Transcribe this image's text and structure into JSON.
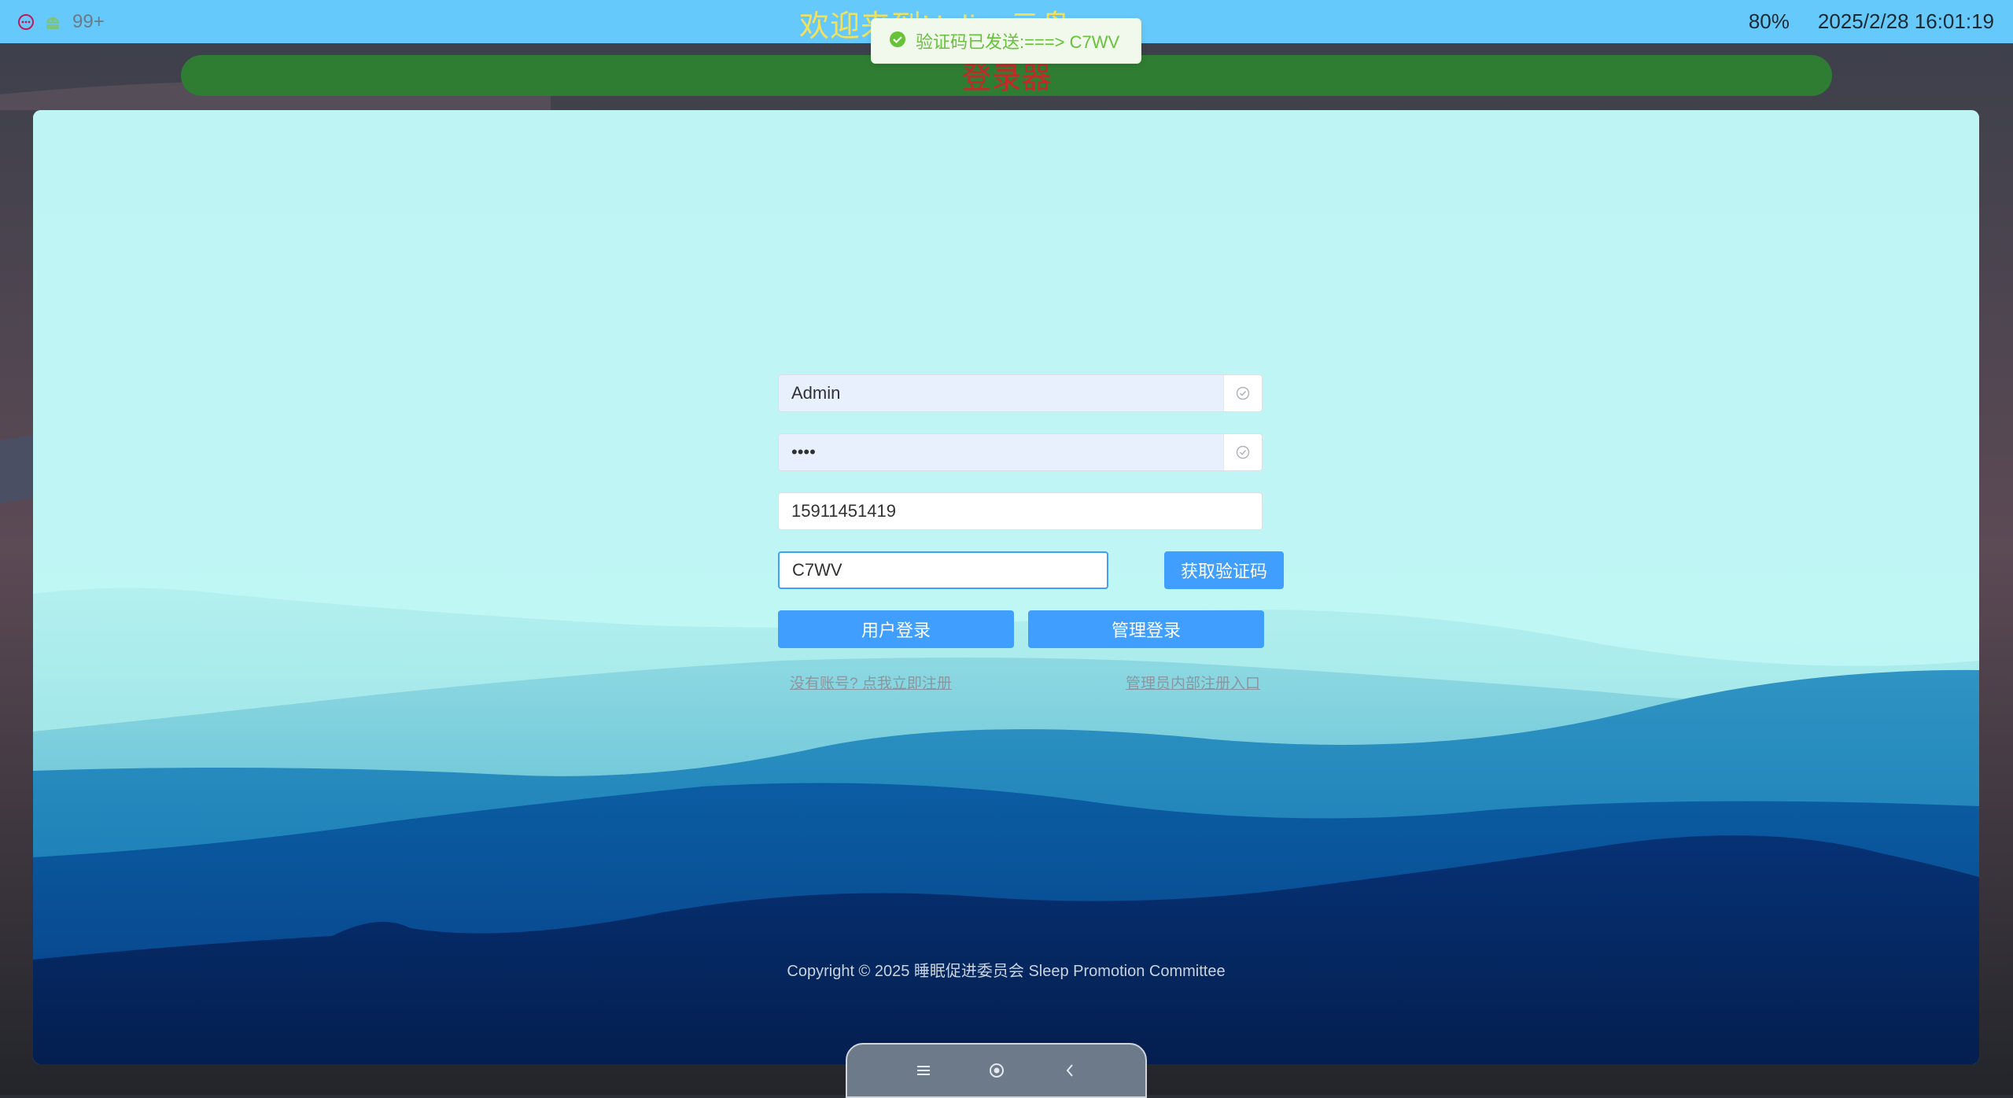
{
  "statusbar": {
    "badge_count": "99+",
    "title": "欢迎来到Helios云盘",
    "zoom": "80%",
    "datetime": "2025/2/28 16:01:19"
  },
  "banner": {
    "title": "登录器"
  },
  "toast": {
    "message": "验证码已发送:===> C7WV"
  },
  "form": {
    "username": "Admin",
    "password": "1234",
    "phone": "15911451419",
    "captcha": "C7WV",
    "get_code_label": "获取验证码",
    "user_login_label": "用户登录",
    "admin_login_label": "管理登录",
    "register_link": "没有账号? 点我立即注册",
    "admin_register_link": "管理员内部注册入口"
  },
  "footer": {
    "copyright": "Copyright © 2025 睡眠促进委员会 Sleep Promotion Committee"
  },
  "colors": {
    "statusbar": "#66c9fb",
    "banner": "#2e7d32",
    "primary": "#409eff",
    "toast_text": "#67c23a"
  }
}
